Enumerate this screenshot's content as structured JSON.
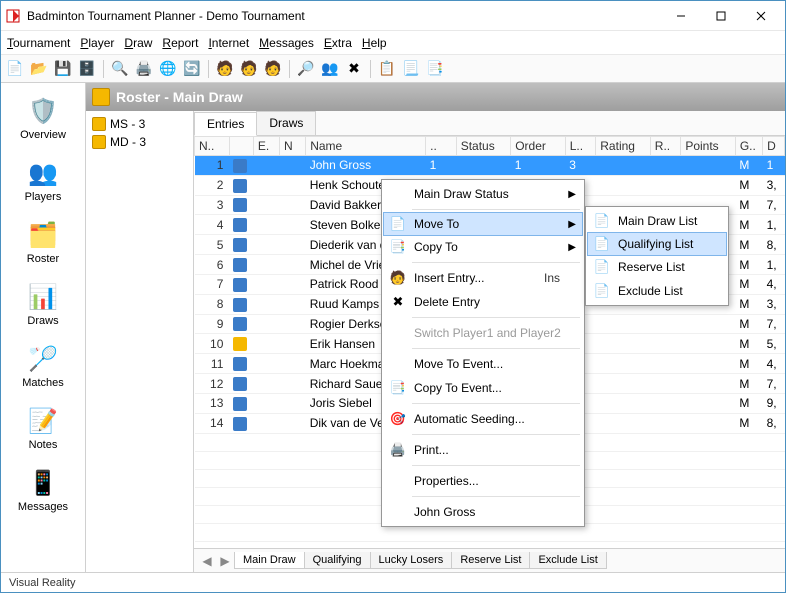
{
  "title": "Badminton Tournament Planner - Demo Tournament",
  "menus": {
    "tournament": "Tournament",
    "player": "Player",
    "draw": "Draw",
    "report": "Report",
    "internet": "Internet",
    "messages": "Messages",
    "extra": "Extra",
    "help": "Help"
  },
  "sidebar": [
    {
      "label": "Overview"
    },
    {
      "label": "Players"
    },
    {
      "label": "Roster"
    },
    {
      "label": "Draws"
    },
    {
      "label": "Matches"
    },
    {
      "label": "Notes"
    },
    {
      "label": "Messages"
    }
  ],
  "header": "Roster - Main Draw",
  "tree": [
    {
      "label": "MS - 3"
    },
    {
      "label": "MD - 3"
    }
  ],
  "topTabs": {
    "entries": "Entries",
    "draws": "Draws",
    "active": "entries"
  },
  "columns": [
    "N..",
    "",
    "E.",
    "N",
    "Name",
    "..",
    "Status",
    "Order",
    "L..",
    "Rating",
    "R..",
    "Points",
    "G..",
    "D"
  ],
  "rows": [
    {
      "n": 1,
      "name": "John Gross",
      "order": 1,
      "l": 3,
      "g": "M",
      "d": 1
    },
    {
      "n": 2,
      "name": "Henk Schouten",
      "g": "M",
      "d": "3,"
    },
    {
      "n": 3,
      "name": "David Bakker",
      "g": "M",
      "d": "7,"
    },
    {
      "n": 4,
      "name": "Steven Bolker",
      "g": "M",
      "d": "1,"
    },
    {
      "n": 5,
      "name": "Diederik van der",
      "g": "M",
      "d": "8,"
    },
    {
      "n": 6,
      "name": "Michel de Vries",
      "g": "M",
      "d": "1,"
    },
    {
      "n": 7,
      "name": "Patrick Rood",
      "g": "M",
      "d": "4,"
    },
    {
      "n": 8,
      "name": "Ruud Kamps",
      "g": "M",
      "d": "3,"
    },
    {
      "n": 9,
      "name": "Rogier Derksen",
      "g": "M",
      "d": "7,"
    },
    {
      "n": 10,
      "name": "Erik Hansen",
      "g": "M",
      "d": "5,"
    },
    {
      "n": 11,
      "name": "Marc Hoekmans",
      "g": "M",
      "d": "4,"
    },
    {
      "n": 12,
      "name": "Richard Sauer",
      "g": "M",
      "d": "7,"
    },
    {
      "n": 13,
      "name": "Joris Siebel",
      "g": "M",
      "d": "9,"
    },
    {
      "n": 14,
      "name": "Dik van de Velden",
      "g": "M",
      "d": "8,"
    }
  ],
  "ctx1": {
    "mainDrawStatus": "Main Draw Status",
    "moveTo": "Move To",
    "copyTo": "Copy To",
    "insertEntry": "Insert Entry...",
    "insertEntryKey": "Ins",
    "deleteEntry": "Delete Entry",
    "switch": "Switch Player1 and Player2",
    "moveToEvent": "Move To Event...",
    "copyToEvent": "Copy To Event...",
    "autoSeed": "Automatic Seeding...",
    "print": "Print...",
    "properties": "Properties...",
    "player": "John Gross"
  },
  "ctx2": {
    "main": "Main Draw List",
    "qual": "Qualifying List",
    "reserve": "Reserve List",
    "exclude": "Exclude List"
  },
  "bottomTabs": [
    "Main Draw",
    "Qualifying",
    "Lucky Losers",
    "Reserve List",
    "Exclude List"
  ],
  "status": "Visual Reality"
}
